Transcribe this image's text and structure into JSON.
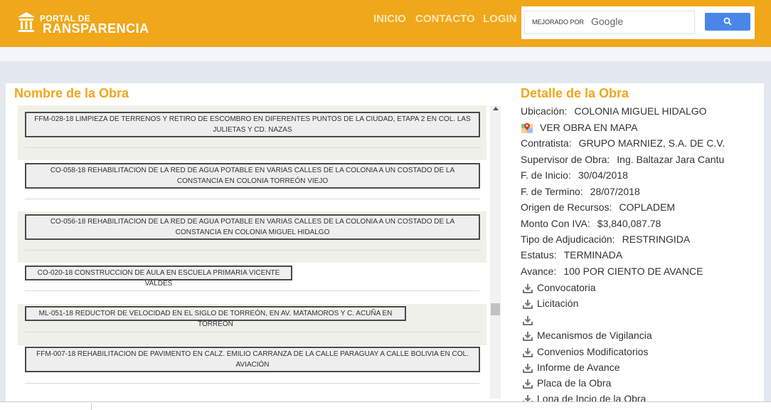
{
  "logo": {
    "line1": "PORTAL DE",
    "line2": "RANSPARENCIA"
  },
  "nav": {
    "inicio": "INICIO",
    "contacto": "CONTACTO",
    "login": "LOGIN"
  },
  "search": {
    "label": "MEJORADO POR",
    "brand": "Google",
    "button_icon": "search-icon"
  },
  "left": {
    "title": "Nombre de la Obra",
    "items": [
      {
        "label": "FFM-028-18 LIMPIEZA DE TERRENOS Y RETIRO DE ESCOMBRO EN DIFERENTES PUNTOS DE LA CIUDAD, ETAPA 2 EN COL. LAS JULIETAS Y CD. NAZAS",
        "shaded": true
      },
      {
        "label": "CO-058-18 REHABILITACION DE LA RED DE AGUA POTABLE EN VARIAS CALLES DE LA COLONIA A UN COSTADO DE LA CONSTANCIA EN COLONIA TORREÓN VIEJO",
        "shaded": false
      },
      {
        "label": "CO-056-18 REHABILITACION DE LA RED DE AGUA POTABLE EN VARIAS CALLES DE LA COLONIA A UN COSTADO DE LA CONSTANCIA EN COLONIA MIGUEL HIDALGO",
        "shaded": true
      },
      {
        "label": "CO-020-18 CONSTRUCCION DE AULA EN ESCUELA PRIMARIA VICENTE VALDES",
        "shaded": false
      },
      {
        "label": "ML-051-18 REDUCTOR DE VELOCIDAD EN EL SIGLO DE TORREÓN, EN AV. MATAMOROS Y C. ACUÑA EN TORREÓN",
        "shaded": true
      },
      {
        "label": "FFM-007-18 REHABILITACION DE PAVIMENTO EN CALZ. EMILIO CARRANZA DE LA CALLE PARAGUAY A CALLE BOLIVIA EN COL. AVIACIÓN",
        "shaded": false
      }
    ]
  },
  "detail": {
    "title": "Detalle de la Obra",
    "ubicacion_label": "Ubicación:",
    "ubicacion": "COLONIA MIGUEL HIDALGO",
    "mapa": "VER OBRA EN MAPA",
    "contratista_label": "Contratista:",
    "contratista": "GRUPO MARNIEZ, S.A. DE C.V.",
    "supervisor_label": "Supervisor de Obra:",
    "supervisor": "Ing. Baltazar Jara Cantu",
    "inicio_label": "F. de Inicio:",
    "inicio": "30/04/2018",
    "termino_label": "F. de Termino:",
    "termino": "28/07/2018",
    "origen_label": "Origen de Recursos:",
    "origen": "COPLADEM",
    "monto_label": "Monto Con IVA:",
    "monto": "$3,840,087.78",
    "adjudicacion_label": "Tipo de Adjudicación:",
    "adjudicacion": "RESTRINGIDA",
    "estatus_label": "Estatus:",
    "estatus": "TERMINADA",
    "avance_label": "Avance:",
    "avance": "100 POR CIENTO DE AVANCE",
    "downloads": [
      "Convocatoria",
      "Licitación",
      "",
      "Mecanismos de Vigilancia",
      "Convenios Modificatorios",
      "Informe de Avance",
      "Placa de la Obra",
      "Lona de Incio de la Obra"
    ]
  },
  "colors": {
    "accent": "#f0a71a",
    "page_bg": "#e3e8f0",
    "button": "#4a86e8"
  }
}
